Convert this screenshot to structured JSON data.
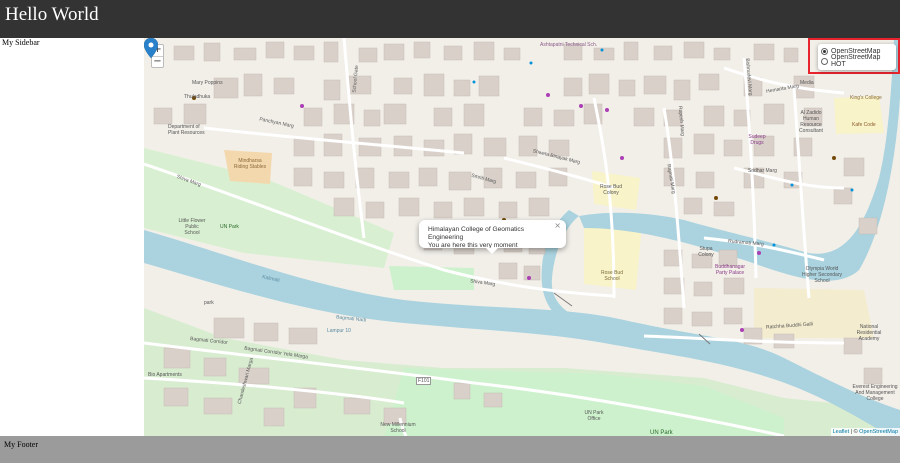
{
  "header": {
    "title": "Hello World"
  },
  "sidebar": {
    "title": "My Sidebar"
  },
  "map": {
    "zoom": {
      "in_label": "+",
      "out_label": "−"
    },
    "layers": [
      {
        "label": "OpenStreetMap",
        "selected": true
      },
      {
        "label": "OpenStreetMap HOT",
        "selected": false
      }
    ],
    "popup": {
      "line1": "Himalayan College of Geomatics Engineering",
      "line2": "You are here this very moment",
      "close": "×"
    },
    "attribution": {
      "leaflet": "Leaflet",
      "separator": " | © ",
      "osm": "OpenStreetMap"
    },
    "labels": {
      "ashtapatni": "Ashtapatni Technical Sch.",
      "mary_poppins": "Mary Poppins",
      "thulodhuka": "Thuladhuka",
      "dept_plant": "Department of Plant Resources",
      "panchyan_marg": "Panchyan Marg",
      "school_gate": "School Gate",
      "bishnudevi": "Bishnudevi Marg",
      "hemanta_marg": "Hemanta Marg",
      "rupesh": "Rupesh Marg",
      "shweta_binayak": "Shweta Binayak Marg",
      "smriti_marg": "Smriti Marg",
      "rajmati": "Rajmati Marg",
      "sridhar_marg": "Sridhar Marg",
      "rudramati_marg": "Rudramati Marg",
      "shiva_marg": "Shiva Marg",
      "shiva_marg2": "Shiva Marg",
      "mindharsa": "Mindharsa Riding Stables",
      "little_flower": "Little Flower Public School",
      "un_park": "UN Park",
      "rose_bud": "Rose Bud School",
      "rose_bud_colony": "Rose Bud Colony",
      "stupa_colony": "Stupa Colony",
      "buddhanagar": "Buddhanagar Party Palace",
      "olympia": "Olympia World Higher Secondary School",
      "rudramati_school": "Rudramati Marg",
      "bagmati_corridor": "Bagmati Corridor Yela Marga",
      "bagmati_corridor2": "Bagmati Corridor",
      "f101": "F101",
      "chandeshwari": "Chandeshwari Marga",
      "bio_apartments": "Bio Apartments",
      "new_millennium": "New Millennium School",
      "un_park_office": "UN Park Office",
      "un_park2": "UN Park",
      "everest": "Everest Engineering And Management College",
      "ratchhe": "Ratchha Buddhi Galli",
      "kings_college": "King's College",
      "al_zadido": "Al Zadido Human Resource Consultant",
      "media": "Media",
      "kafe_code": "Kafe Code",
      "sudeep": "Sudeep Drugs",
      "national": "National Residential Academy",
      "lampur": "Lampur 10",
      "bagmati_river_label": "Bagmati Nadi",
      "park": "park",
      "kalimati": "Kalimati"
    }
  },
  "footer": {
    "text": "My Footer"
  },
  "colors": {
    "header_bg": "#333333",
    "footer_bg": "#9b9b9b",
    "highlight": "#e8242e",
    "marker": "#2a81cb",
    "river": "#aad3df",
    "park": "#cdf1cd",
    "building": "#d9d0c9"
  }
}
